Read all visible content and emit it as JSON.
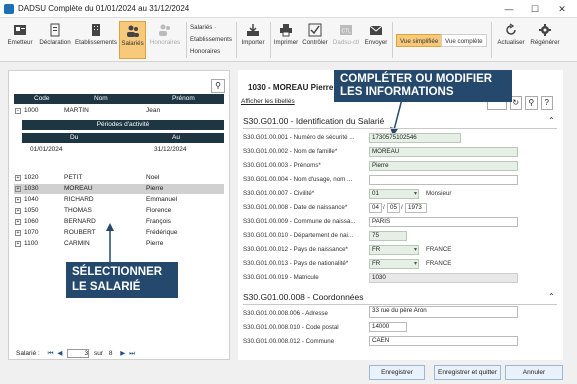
{
  "window": {
    "title": "DADSU Complète du 01/01/2024 au 31/12/2024",
    "min": "—",
    "max": "☐",
    "close": "✕"
  },
  "ribbon": {
    "emetteur": "Emetteur",
    "declaration": "Déclaration",
    "etablissements": "Etablissements",
    "salaries": "Salariés",
    "honoraires": "Honoraires",
    "menu": [
      "Salariés ·",
      "Etablissements",
      "Honoraires"
    ],
    "importer": "Importer",
    "imprimer": "Imprimer",
    "controler": "Contrôler",
    "dadsu_ctl": "Dadsu-ctl",
    "envoyer": "Envoyer",
    "vue_simplifiee": "Vue simplifiée",
    "vue_complete": "Vue complète",
    "actualiser": "Actualiser",
    "regenerer": "Régénérer"
  },
  "left": {
    "headers": [
      "Code",
      "Nom",
      "Prénom"
    ],
    "first_row": {
      "code": "1000",
      "nom": "MARTIN",
      "prenom": "Jean"
    },
    "periods_title": "Périodes d'activité",
    "period_headers": [
      "Du",
      "Au"
    ],
    "period_row": {
      "du": "01/01/2024",
      "au": "31/12/2024"
    },
    "rows": [
      {
        "code": "1020",
        "nom": "PETIT",
        "prenom": "Noel"
      },
      {
        "code": "1030",
        "nom": "MOREAU",
        "prenom": "Pierre"
      },
      {
        "code": "1040",
        "nom": "RICHARD",
        "prenom": "Emmanuel"
      },
      {
        "code": "1050",
        "nom": "THOMAS",
        "prenom": "Florence"
      },
      {
        "code": "1060",
        "nom": "BERNARD",
        "prenom": "François"
      },
      {
        "code": "1070",
        "nom": "ROUBERT",
        "prenom": "Frédérique"
      },
      {
        "code": "1100",
        "nom": "CARMIN",
        "prenom": "Pierre"
      }
    ],
    "nav_label": "Salarié :",
    "nav_current": "3",
    "nav_sep": "sur",
    "nav_total": "8"
  },
  "callouts": {
    "left": [
      "SÉLECTIONNER",
      "LE SALARIÉ"
    ],
    "right": [
      "COMPLÉTER OU MODIFIER",
      "LES INFORMATIONS"
    ]
  },
  "right": {
    "header": "1030 - MOREAU Pierre",
    "show_labels": "Afficher les libellés",
    "section1": "S30.G01.00 - Identification du Salarié",
    "fields1": [
      {
        "label": "S30.G01.00.001 - Numéro de sécurité ...",
        "value": "1730575102546"
      },
      {
        "label": "S30.G01.00.002 - Nom de famille*",
        "value": "MOREAU"
      },
      {
        "label": "S30.G01.00.003 - Prénoms*",
        "value": "Pierre"
      },
      {
        "label": "S30.G01.00.004 - Nom d'usage, nom ...",
        "value": ""
      },
      {
        "label": "S30.G01.00.007 - Civilité*",
        "value": "01",
        "extra": "Monsieur"
      },
      {
        "label": "S30.G01.00.008 - Date de naissance*",
        "day": "04",
        "month": "05",
        "year": "1973"
      },
      {
        "label": "S30.G01.00.009 - Commune de naissa...",
        "value": "PARIS"
      },
      {
        "label": "S30.G01.00.010 - Département de nai...",
        "value": "75"
      },
      {
        "label": "S30.G01.00.012 - Pays de naissance*",
        "value": "FR",
        "extra": "FRANCE"
      },
      {
        "label": "S30.G01.00.013 - Pays de nationalité*",
        "value": "FR",
        "extra": "FRANCE"
      },
      {
        "label": "S30.G01.00.019 - Matricule",
        "value": "1030"
      }
    ],
    "section2": "S30.G01.00.008 - Coordonnées",
    "fields2": [
      {
        "label": "S30.G01.00.008.006 - Adresse",
        "value": "33 rue du père Aron"
      },
      {
        "label": "S30.G01.00.008.010 - Code postal",
        "value": "14000"
      },
      {
        "label": "S30.G01.00.008.012 - Commune",
        "value": "CAEN"
      }
    ]
  },
  "footer": {
    "enregistrer": "Enregistrer",
    "enregistrer_quitter": "Enregistrer et quitter",
    "annuler": "Annuler"
  },
  "colors": {
    "accent": "#f7c97b",
    "callout": "#24496d",
    "table_header": "#1e3642"
  }
}
